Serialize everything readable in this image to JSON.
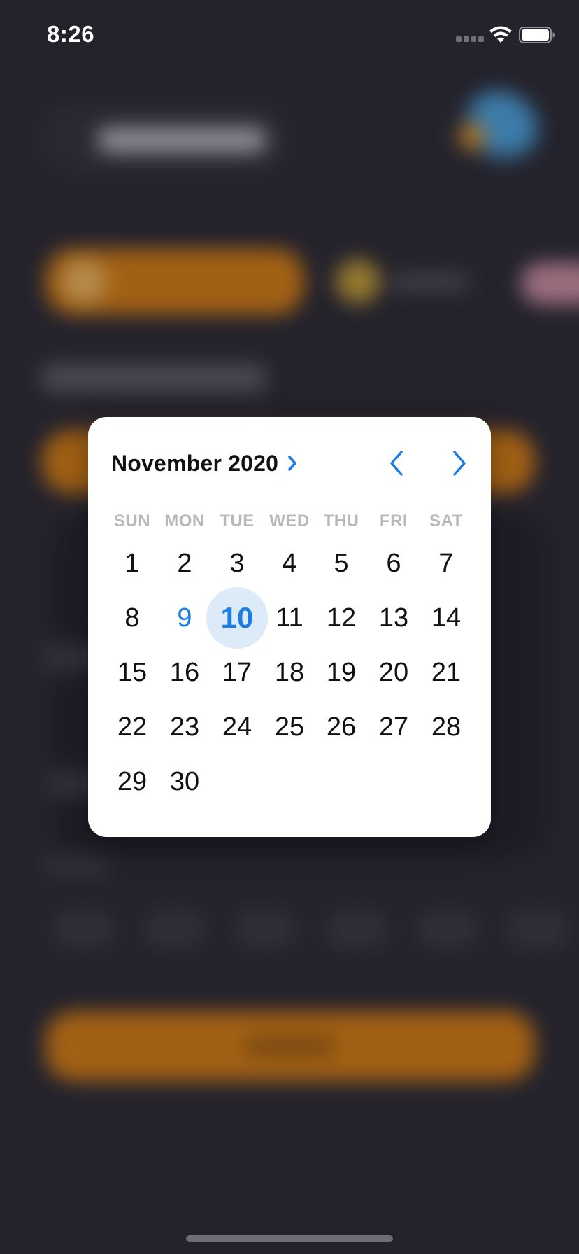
{
  "status_bar": {
    "time": "8:26",
    "wifi_icon": "wifi-icon",
    "battery_icon": "battery-full-icon",
    "signal_icon": "cellular-signal-icon"
  },
  "calendar": {
    "month_title": "November 2020",
    "month_chevron_icon": "chevron-right-icon",
    "prev_icon": "chevron-left-icon",
    "next_icon": "chevron-right-icon",
    "accent_color": "#1a7ee6",
    "selected_bg_color": "#ddeaf8",
    "weekdays": [
      "SUN",
      "MON",
      "TUE",
      "WED",
      "THU",
      "FRI",
      "SAT"
    ],
    "first_weekday_index": 0,
    "days": [
      "1",
      "2",
      "3",
      "4",
      "5",
      "6",
      "7",
      "8",
      "9",
      "10",
      "11",
      "12",
      "13",
      "14",
      "15",
      "16",
      "17",
      "18",
      "19",
      "20",
      "21",
      "22",
      "23",
      "24",
      "25",
      "26",
      "27",
      "28",
      "29",
      "30"
    ],
    "today": "9",
    "selected": "10"
  }
}
